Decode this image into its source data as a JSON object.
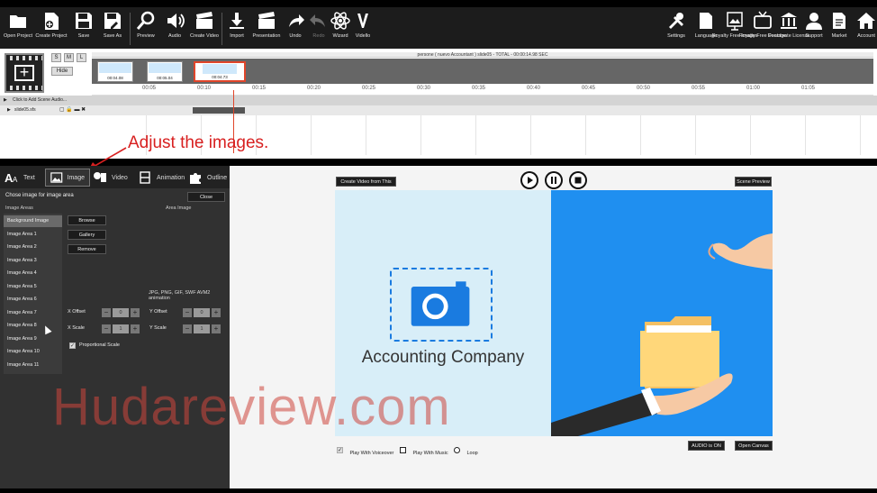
{
  "toolbar": {
    "left_items": [
      {
        "label": "Open Project",
        "icon": "folder-open-icon"
      },
      {
        "label": "Create Project",
        "icon": "new-file-icon"
      },
      {
        "label": "Save",
        "icon": "floppy-disk-icon"
      },
      {
        "label": "Save As",
        "icon": "floppy-disk-edit-icon"
      },
      {
        "label": "Preview",
        "icon": "magnifier-icon"
      },
      {
        "label": "Audio",
        "icon": "speaker-icon"
      },
      {
        "label": "Create Video",
        "icon": "clapperboard-icon"
      },
      {
        "label": "Import",
        "icon": "download-arrow-icon"
      },
      {
        "label": "Presentation",
        "icon": "clapperboard-icon"
      },
      {
        "label": "Undo",
        "icon": "undo-arrow-icon"
      },
      {
        "label": "Redo",
        "icon": "redo-arrow-icon"
      },
      {
        "label": "Wizard",
        "icon": "atom-icon"
      },
      {
        "label": "Vidello",
        "icon": "v-letter-icon"
      }
    ],
    "right_items": [
      {
        "label": "Settings",
        "icon": "tools-icon"
      },
      {
        "label": "Language",
        "icon": "document-icon"
      },
      {
        "label": "Royalty Free Images",
        "icon": "image-chart-icon"
      },
      {
        "label": "Royalty Free Footage",
        "icon": "tv-icon"
      },
      {
        "label": "Deactivate License",
        "icon": "bank-icon"
      },
      {
        "label": "Support",
        "icon": "support-person-icon"
      },
      {
        "label": "Market",
        "icon": "market-document-icon"
      },
      {
        "label": "Account",
        "icon": "home-icon"
      }
    ]
  },
  "timeline": {
    "size_buttons": [
      "S",
      "M",
      "L"
    ],
    "hide_label": "Hide",
    "title_bar": "persone ( nuevo Accountant )   slide05  -  TOTAL  -  00:00:14.98 SEC",
    "scenes": [
      {
        "time": "00:04.08"
      },
      {
        "time": "00:05.04"
      },
      {
        "time": "00:04.73"
      }
    ],
    "ticks": [
      "00:05",
      "00:10",
      "00:15",
      "00:20",
      "00:25",
      "00:30",
      "00:35",
      "00:40",
      "00:45",
      "00:50",
      "00:55",
      "01:00",
      "01:05"
    ],
    "audio_row": "Click to Add Scene Audio...",
    "file_row": "slide05.sfs"
  },
  "annotation": {
    "text": "Adjust the images."
  },
  "editor": {
    "tabs": [
      {
        "label": "Text",
        "icon": "text-aa-icon"
      },
      {
        "label": "Image",
        "icon": "picture-icon"
      },
      {
        "label": "Video",
        "icon": "video-camera-icon"
      },
      {
        "label": "Animation",
        "icon": "animation-frames-icon"
      },
      {
        "label": "Outline",
        "icon": "puzzle-icon"
      }
    ],
    "heading": "Chose image for image area",
    "close_label": "Close",
    "image_areas_label": "Image Areas",
    "area_image_label": "Area Image",
    "areas": [
      "Background Image",
      "Image Area 1",
      "Image Area 2",
      "Image Area 3",
      "Image Area 4",
      "Image Area 5",
      "Image Area 6",
      "Image Area 7",
      "Image Area 8",
      "Image Area 9",
      "Image Area 10",
      "Image Area 11"
    ],
    "buttons": {
      "browse": "Browse",
      "gallery": "Gallery",
      "remove": "Remove"
    },
    "formats": "JPG, PNG, GIF, SWF AVM2 animation",
    "x_offset": {
      "label": "X Offset",
      "value": "0"
    },
    "y_offset": {
      "label": "Y Offset",
      "value": "0"
    },
    "x_scale": {
      "label": "X Scale",
      "value": "1"
    },
    "y_scale": {
      "label": "Y Scale",
      "value": "1"
    },
    "proportional_scale": {
      "label": "Proportional Scale",
      "checked": true
    }
  },
  "preview": {
    "create_video_label": "Create Video from This Scene",
    "scene_preview_label": "Scene Preview",
    "company_name": "Accounting Company",
    "options": {
      "voiceover": {
        "label": "Play With Voiceover",
        "checked": true
      },
      "music": {
        "label": "Play With Music",
        "checked": false
      },
      "loop": {
        "label": "Loop",
        "checked": false
      }
    },
    "audio_label": "AUDIO is ON",
    "open_canvas_label": "Open Canvas",
    "colors": {
      "canvas_left": "#d8eef8",
      "canvas_right": "#1f8ff0",
      "accent": "#1a7be0"
    }
  },
  "watermark": {
    "text": "Hudareview.com"
  }
}
